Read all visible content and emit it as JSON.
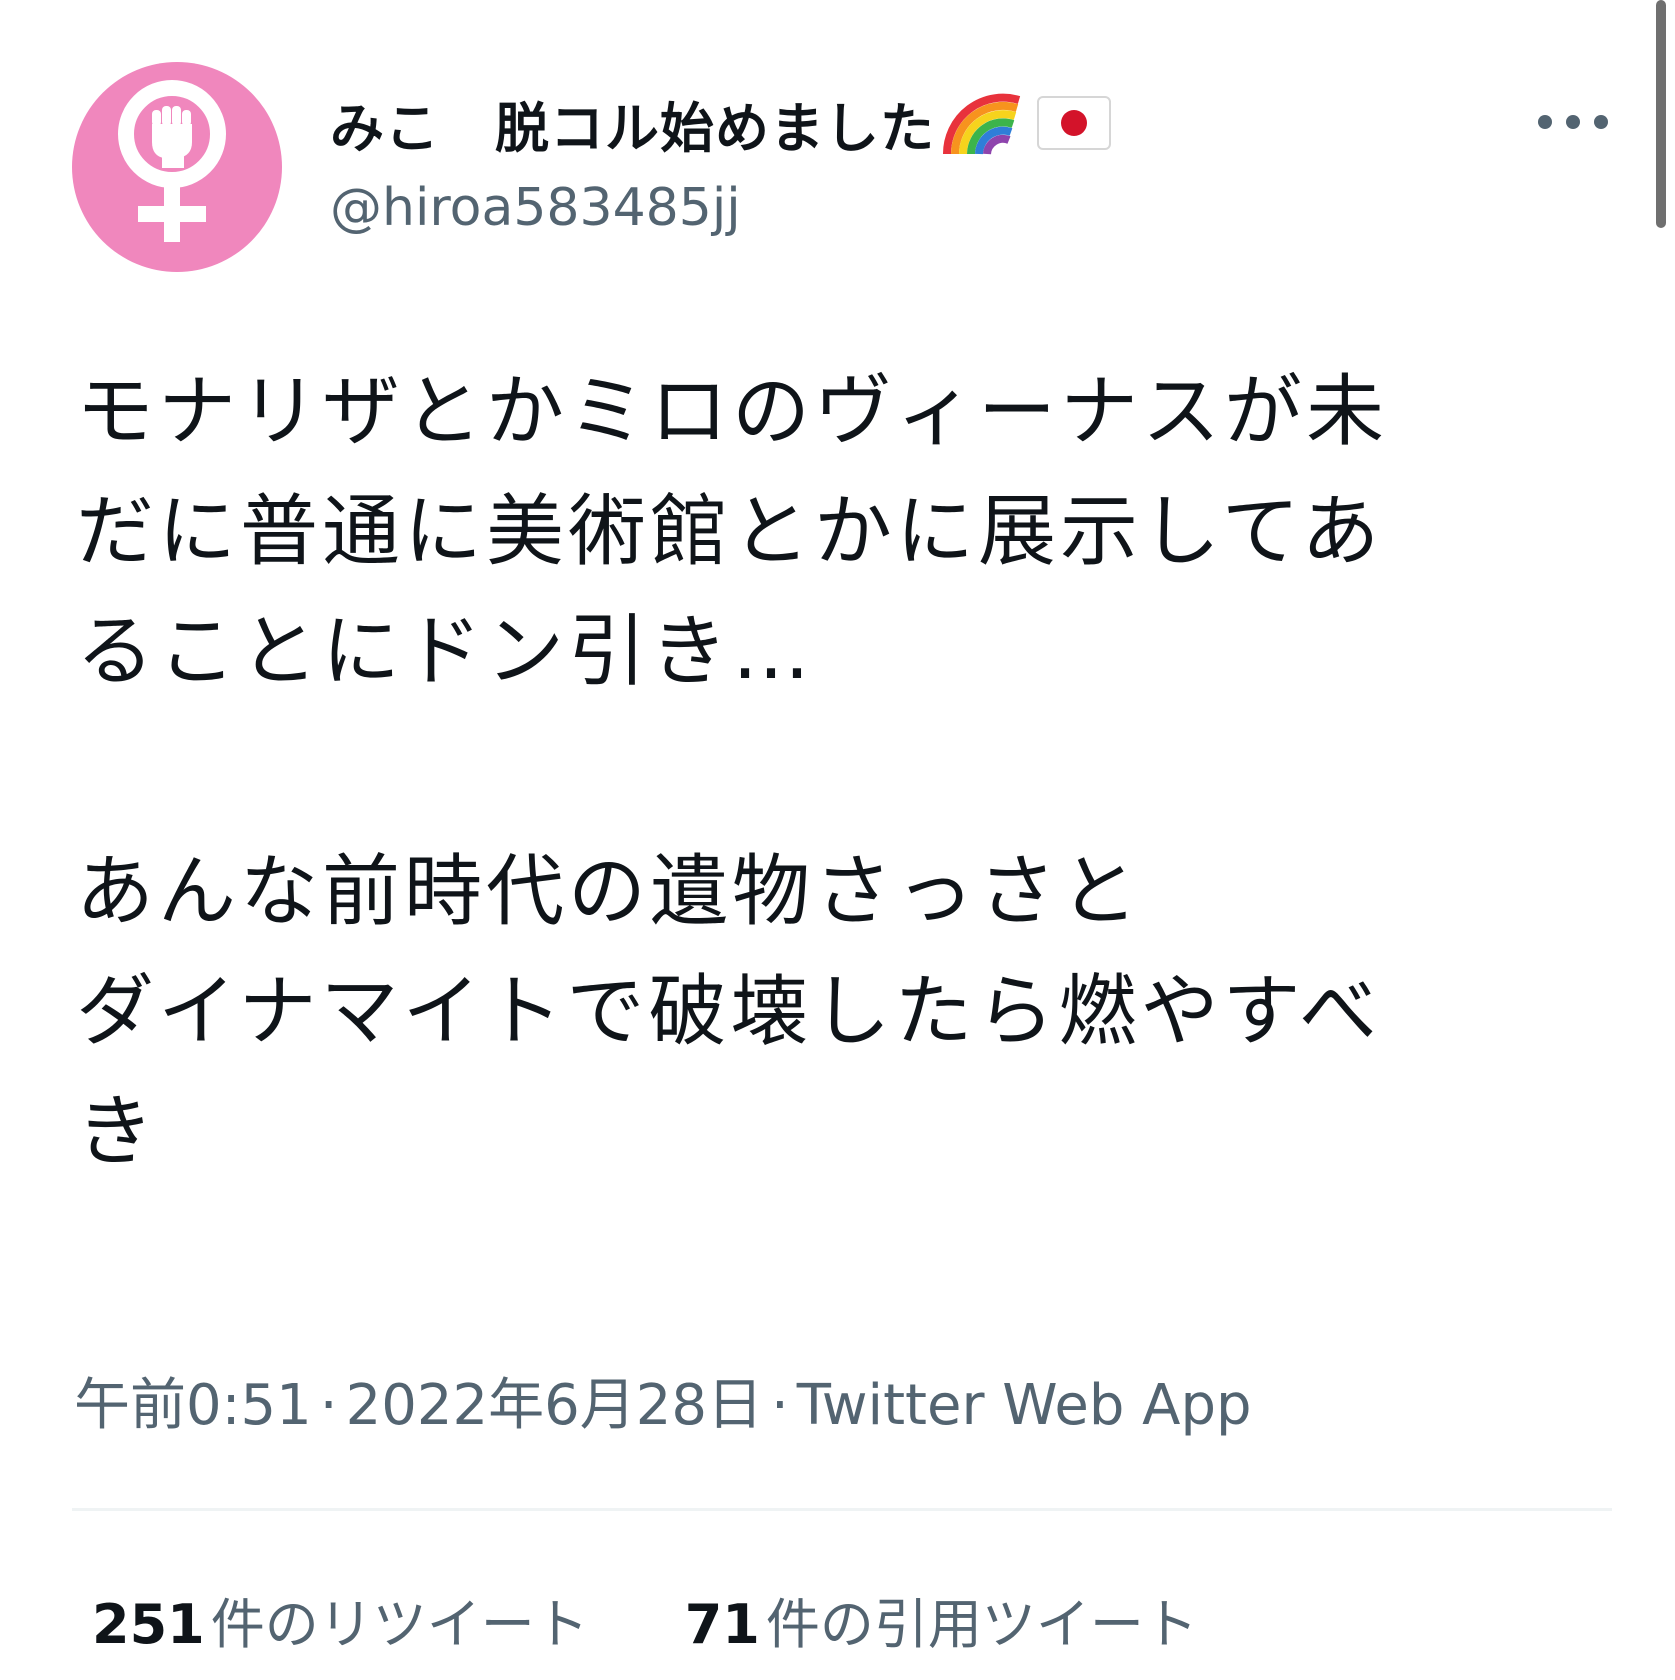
{
  "user": {
    "display_name": "みこ　脱コル始めました",
    "name_emoji": [
      "rainbow-icon",
      "japan-flag-icon"
    ],
    "handle": "@hiroa583485jj",
    "avatar": "venus-fist-icon",
    "avatar_color": "#f087bd"
  },
  "tweet": {
    "text": "モナリザとかミロのヴィーナスが未\nだに普通に美術館とかに展示してあ\nることにドン引き…\n\nあんな前時代の遺物さっさと\nダイナマイトで破壊したら燃やすべ\nき"
  },
  "meta": {
    "time": "午前0:51",
    "separator": "·",
    "date": "2022年6月28日",
    "source": "Twitter Web App"
  },
  "stats": {
    "retweets_count": "251",
    "retweets_label": "件のリツイート",
    "quotes_count": "71",
    "quotes_label": "件の引用ツイート"
  },
  "colors": {
    "text_primary": "#0f1419",
    "text_secondary": "#536471",
    "divider": "#eff3f4"
  }
}
